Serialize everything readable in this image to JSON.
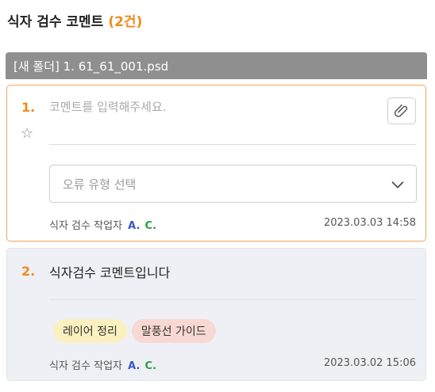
{
  "header": {
    "title": "식자 검수 코멘트",
    "count": "(2건)"
  },
  "folder": {
    "label": "[새 폴더] 1. 61_61_001.psd"
  },
  "form": {
    "number": "1.",
    "comment_placeholder": "코멘트를 입력해주세요.",
    "error_type_placeholder": "오류 유형 선택",
    "meta_label": "식자 검수 작업자",
    "meta_initial_a": "A.",
    "meta_initial_c": "C.",
    "date": "2023.03.03 14:58",
    "icons": {
      "star": "star-outline-icon",
      "attach": "paperclip-icon",
      "dropdown": "chevron-down-icon"
    }
  },
  "comments": [
    {
      "number": "2.",
      "text": "식자검수 코멘트입니다",
      "tags": [
        "레이어 정리",
        "말풍선 가이드"
      ],
      "meta_label": "식자 검수 작업자",
      "meta_initial_a": "A.",
      "meta_initial_c": "C.",
      "date": "2023.03.02 15:06"
    }
  ],
  "colors": {
    "accent": "#f08a1c",
    "folder_bar": "#8f8f8f",
    "active_border": "#f2a55a",
    "card_bg": "#eef0f5",
    "initial_a": "#3a57c4",
    "initial_c": "#2c9e3c",
    "tag_yellow": "#fbf0bf",
    "tag_pink": "#f8d8d2"
  }
}
